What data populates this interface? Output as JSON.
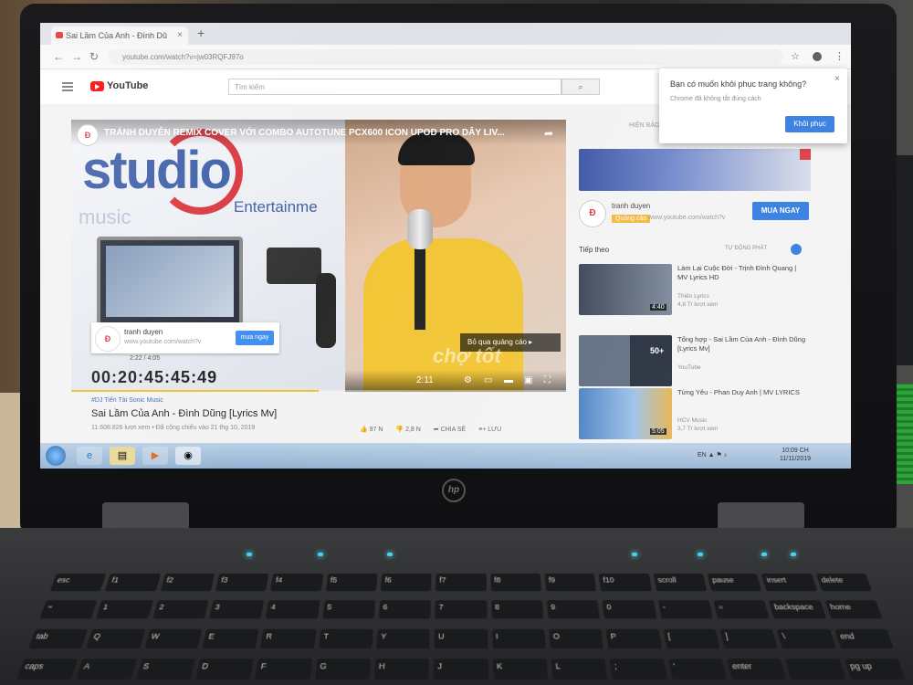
{
  "browser": {
    "tab_title": "Sai Lầm Của Anh - Đình Dũ",
    "tab_close": "×",
    "new_tab": "+",
    "url": "youtube.com/watch?v=jw03RQFJ97o",
    "back": "←",
    "forward": "→",
    "reload": "↻",
    "star": "☆",
    "menu": "⋮"
  },
  "youtube": {
    "logo_text": "YouTube",
    "search_placeholder": "Tìm kiếm",
    "search_icon": "⌕"
  },
  "video": {
    "title": "TRÁNH DUYÊN REMIX COVER VỚI COMBO AUTOTUNE PCX600 ICON UPOD PRO DÂY LIV...",
    "share_icon": "➦",
    "channel_badge": "Đ",
    "overlay_brand": "studio",
    "overlay_entertain": "Entertainme",
    "overlay_music": "music",
    "promo_name": "tranh duyen",
    "promo_url": "www.youtube.com/watch?v",
    "promo_button": "mua ngay",
    "timecode_small": "2:22 / 4:05",
    "big_timecode": "00:20:45:45:49",
    "skip_ad": "Bỏ qua quảng cáo ▸",
    "controls_time": "2:11",
    "progress_percent": 50
  },
  "meta": {
    "tags": "#DJ Tiến Tài Sonic Music",
    "title": "Sai Lầm Của Anh - Đình Dũng [Lyrics Mv]",
    "views": "11.608.826 lượt xem • Đã công chiếu vào 21 thg 10, 2019",
    "likes": "👍 97 N",
    "dislikes": "👎 2,8 N",
    "share": "➦ CHIA SẺ",
    "save": "≡+ LƯU"
  },
  "sidebar": {
    "label": "HIỆN BÁO",
    "sponsor_logo": "Đ",
    "sponsor_name": "tranh duyen",
    "sponsor_tag": "Quảng cáo",
    "sponsor_url": "www.youtube.com/watch?v",
    "buy_button": "MUA NGAY",
    "up_next": "Tiếp theo",
    "autoplay": "TỰ ĐỘNG PHÁT",
    "recommendations": [
      {
        "title": "Làm Lại Cuộc Đời - Trịnh Đình Quang | MV Lyrics HD",
        "channel": "Thiên Lyrics",
        "views": "4,8 Tr lượt xem",
        "duration": "4:40"
      },
      {
        "title": "Tổng hợp - Sai Lầm Của Anh - Đình Dũng [Lyrics Mv]",
        "channel": "YouTube",
        "views": "",
        "duration": "50+"
      },
      {
        "title": "Từng Yêu - Phan Duy Anh | MV LYRICS",
        "channel": "HCV Music",
        "views": "3,7 Tr lượt xem",
        "duration": "5:05"
      }
    ]
  },
  "popup": {
    "title": "Bạn có muốn khôi phục trang không?",
    "body": "Chrome đã không tắt đúng cách",
    "button": "Khôi phục",
    "close": "×"
  },
  "taskbar": {
    "tray": "EN ▲ ⚑ ♪",
    "clock_time": "10:09 CH",
    "clock_date": "11/11/2019"
  },
  "watermark": "chợ tốt",
  "laptop": {
    "logo": "hp",
    "keys": [
      "esc",
      "f1",
      "f2",
      "f3",
      "f4",
      "f5",
      "f6",
      "f7",
      "f8",
      "f9",
      "f10",
      "scroll",
      "pause",
      "insert",
      "delete",
      "~",
      "1",
      "2",
      "3",
      "4",
      "5",
      "6",
      "7",
      "8",
      "9",
      "0",
      "-",
      "=",
      "backspace",
      "home",
      "tab",
      "Q",
      "W",
      "E",
      "R",
      "T",
      "Y",
      "U",
      "I",
      "O",
      "P",
      "[",
      "]",
      "\\",
      "end",
      "caps",
      "A",
      "S",
      "D",
      "F",
      "G",
      "H",
      "J",
      "K",
      "L",
      ";",
      "'",
      "enter",
      "",
      "pg up"
    ]
  }
}
